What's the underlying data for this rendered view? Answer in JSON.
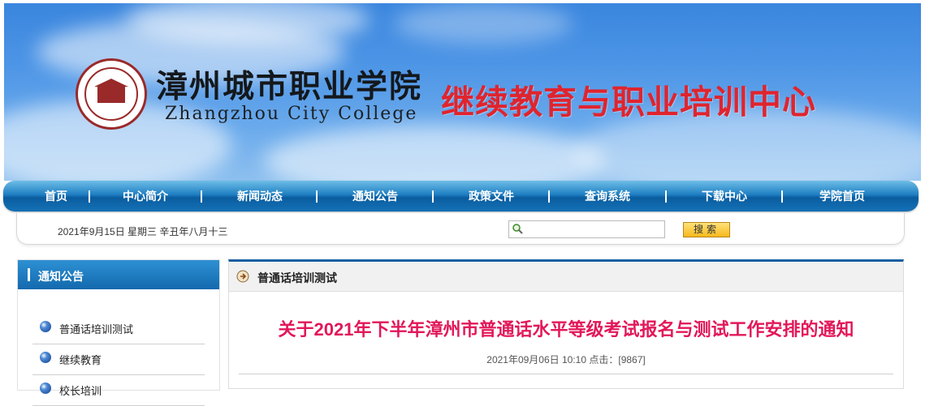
{
  "header": {
    "college_name_cn": "漳州城市职业学院",
    "college_name_en": "Zhangzhou City College",
    "center_title": "继续教育与职业培训中心",
    "center_title_color": "#e0242e"
  },
  "nav": {
    "items": [
      "首页",
      "中心简介",
      "新闻动态",
      "通知公告",
      "政策文件",
      "查询系统",
      "下载中心",
      "学院首页"
    ]
  },
  "infobar": {
    "date_text": "2021年9月15日  星期三  辛丑年八月十三",
    "search_placeholder": "",
    "search_button": "搜索"
  },
  "sidebar": {
    "title": "通知公告",
    "items": [
      {
        "label": "普通话培训测试",
        "icon": "blue-bullet-icon"
      },
      {
        "label": "继续教育",
        "icon": "blue-bullet-icon"
      },
      {
        "label": "校长培训",
        "icon": "blue-bullet-icon"
      }
    ]
  },
  "main": {
    "section_title": "普通话培训测试",
    "article_title": "关于2021年下半年漳州市普通话水平等级考试报名与测试工作安排的通知",
    "article_title_color": "#e2175a",
    "meta": "2021年09月06日 10:10  点击：[9867]"
  }
}
